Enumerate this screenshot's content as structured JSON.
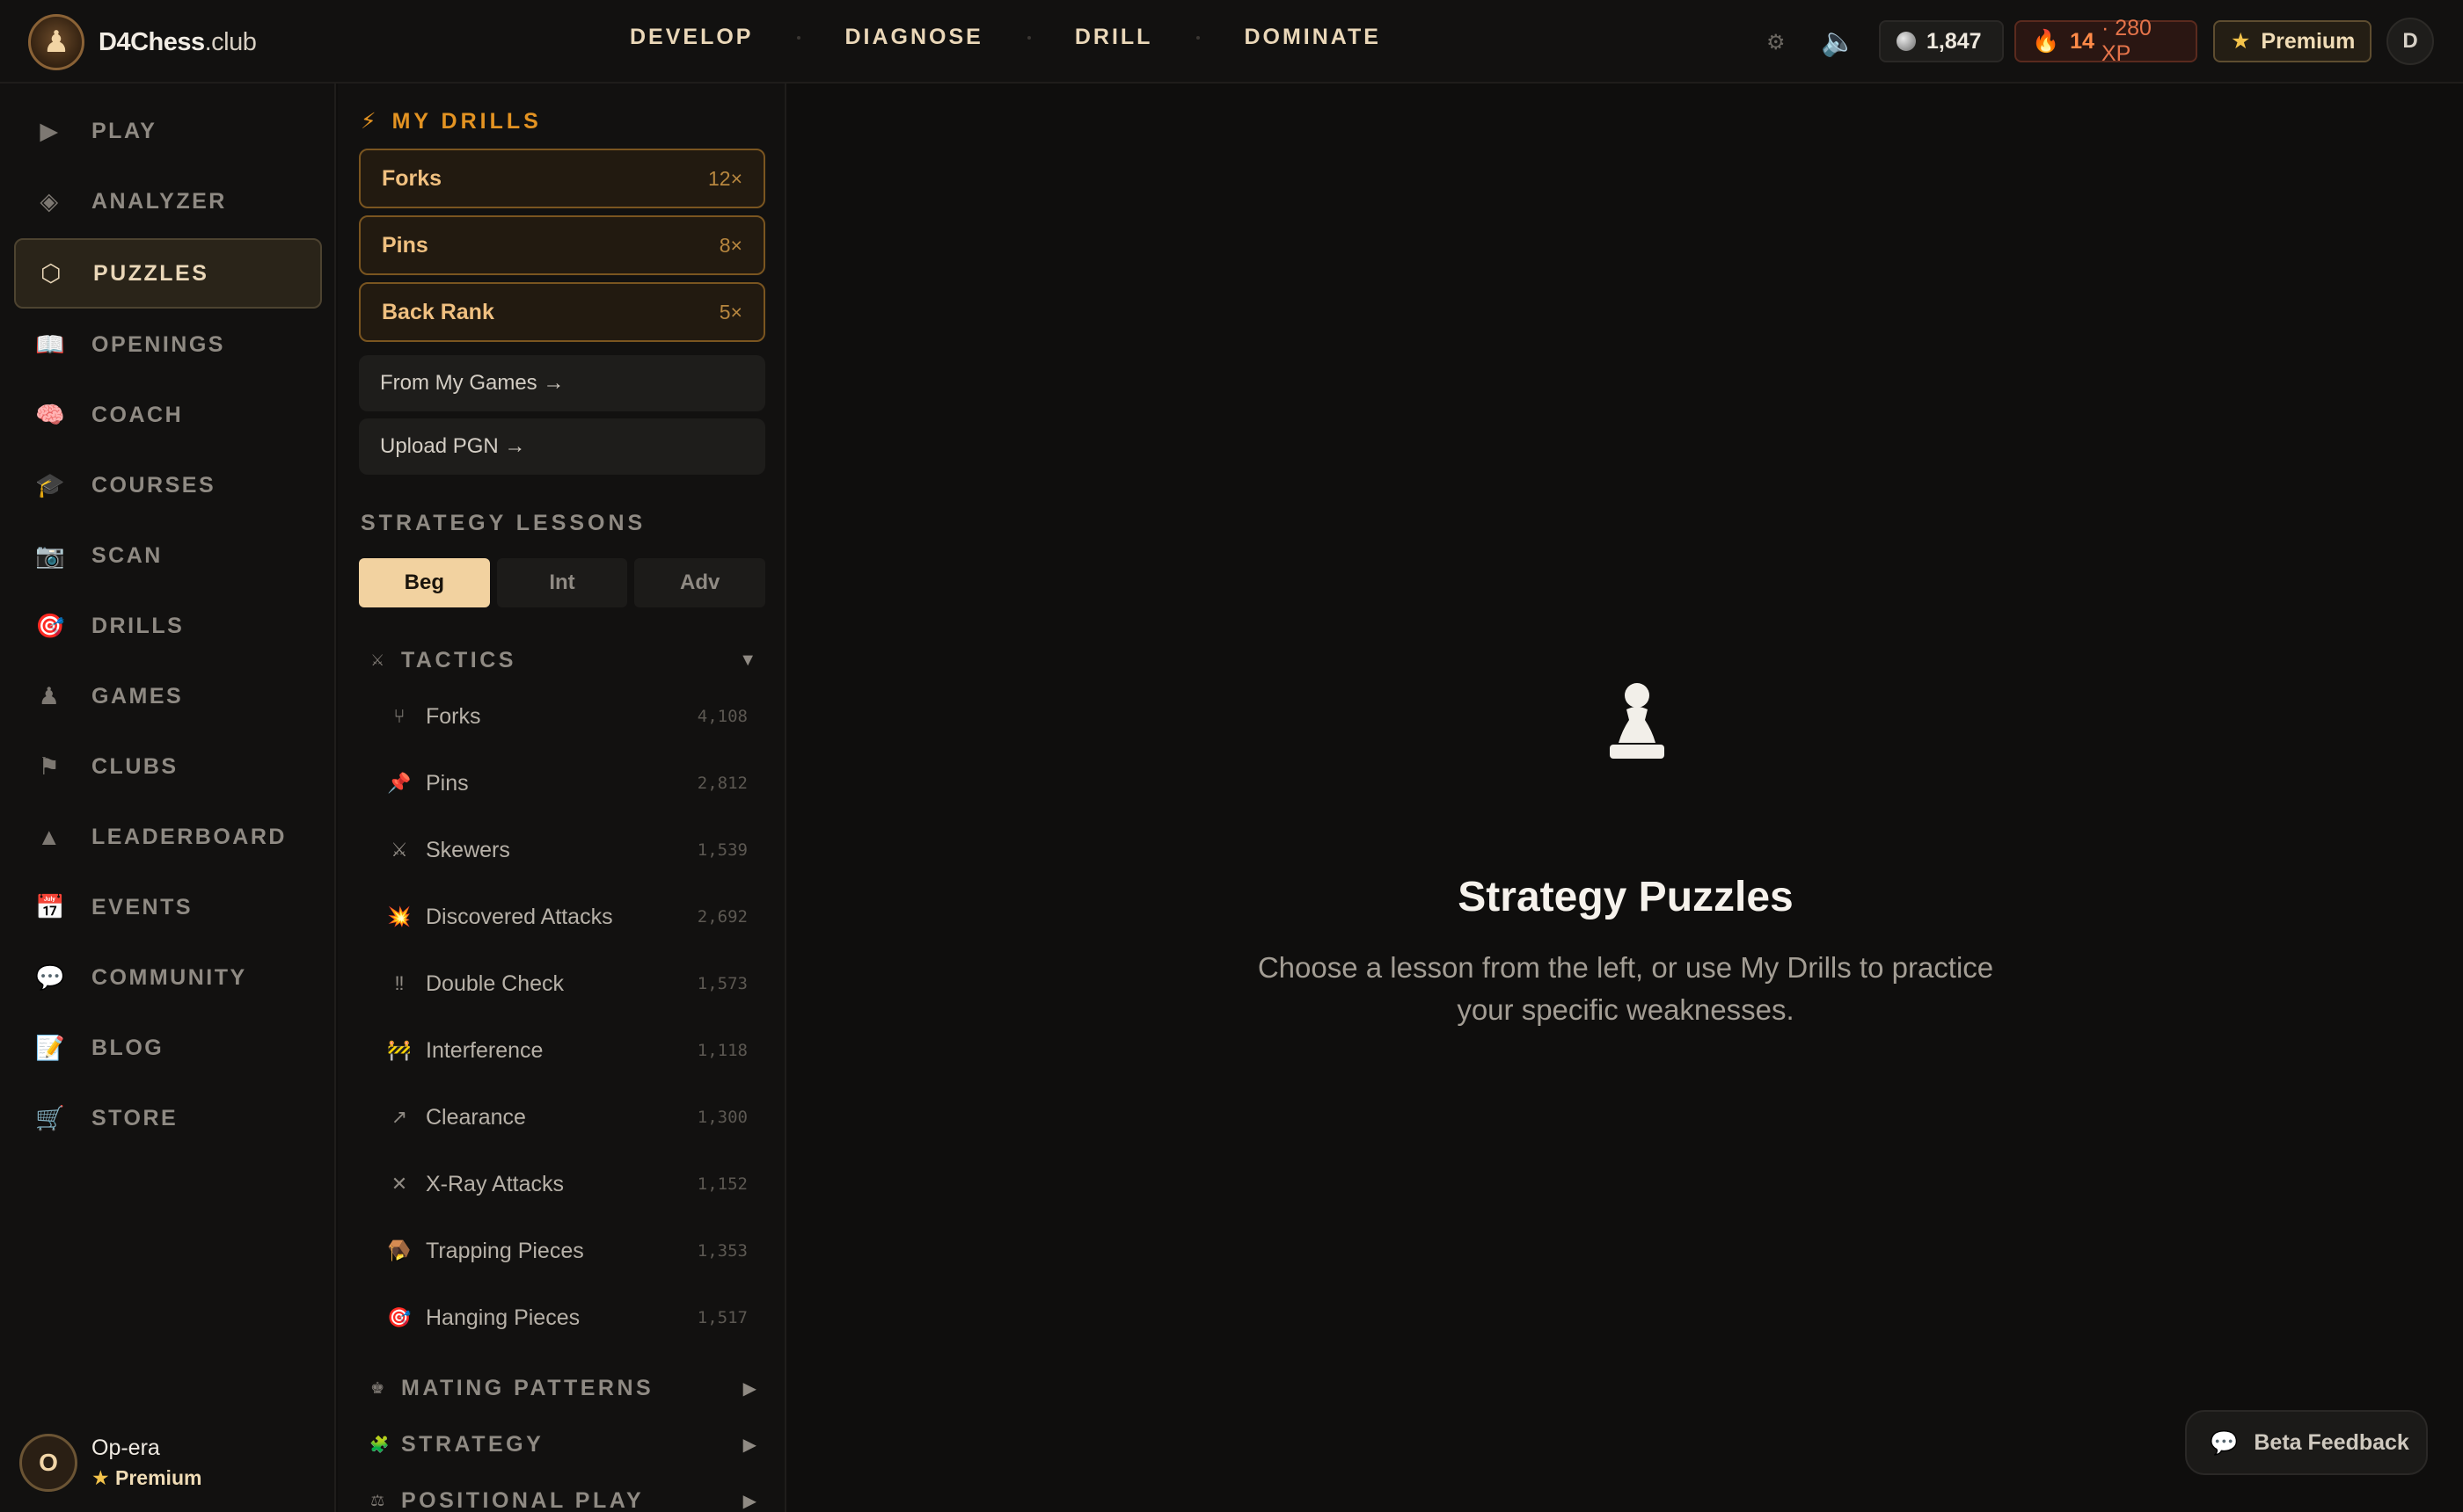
{
  "brand": {
    "name": "D4Chess",
    "suffix": ".club"
  },
  "nav": [
    "DEVELOP",
    "DIAGNOSE",
    "DRILL",
    "DOMINATE"
  ],
  "header": {
    "rating": "1,847",
    "streak": "14",
    "xp": "· 280 XP",
    "premium_label": "Premium",
    "avatar_initial": "D"
  },
  "sidebar": {
    "items": [
      {
        "label": "PLAY",
        "icon": "play-icon"
      },
      {
        "label": "ANALYZER",
        "icon": "diamond-icon"
      },
      {
        "label": "PUZZLES",
        "icon": "hexagon-icon"
      },
      {
        "label": "OPENINGS",
        "icon": "book-icon"
      },
      {
        "label": "COACH",
        "icon": "brain-icon"
      },
      {
        "label": "COURSES",
        "icon": "graduation-cap-icon"
      },
      {
        "label": "SCAN",
        "icon": "camera-icon"
      },
      {
        "label": "DRILLS",
        "icon": "target-icon"
      },
      {
        "label": "GAMES",
        "icon": "pawn-icon"
      },
      {
        "label": "CLUBS",
        "icon": "flag-icon"
      },
      {
        "label": "LEADERBOARD",
        "icon": "triangle-icon"
      },
      {
        "label": "EVENTS",
        "icon": "calendar-icon"
      },
      {
        "label": "COMMUNITY",
        "icon": "speech-bubble-icon"
      },
      {
        "label": "BLOG",
        "icon": "memo-icon"
      },
      {
        "label": "STORE",
        "icon": "cart-icon"
      }
    ],
    "active": "PUZZLES",
    "user": {
      "initial": "O",
      "name": "Op-era",
      "tier": "Premium"
    }
  },
  "panel": {
    "my_drills_title": "MY DRILLS",
    "drills": [
      {
        "label": "Forks",
        "count": "12×"
      },
      {
        "label": "Pins",
        "count": "8×"
      },
      {
        "label": "Back Rank",
        "count": "5×"
      }
    ],
    "links": [
      "From My Games →",
      "Upload PGN →"
    ],
    "strategy_title": "STRATEGY LESSONS",
    "levels": [
      "Beg",
      "Int",
      "Adv"
    ],
    "active_level": "Beg",
    "categories": {
      "tactics": "TACTICS",
      "mating": "MATING PATTERNS",
      "strategy": "STRATEGY",
      "positional": "POSITIONAL PLAY"
    },
    "lessons": [
      {
        "name": "Forks",
        "count": "4,108",
        "icon": "fork-icon"
      },
      {
        "name": "Pins",
        "count": "2,812",
        "icon": "pushpin-icon"
      },
      {
        "name": "Skewers",
        "count": "1,539",
        "icon": "swords-icon"
      },
      {
        "name": "Discovered Attacks",
        "count": "2,692",
        "icon": "explosion-icon"
      },
      {
        "name": "Double Check",
        "count": "1,573",
        "icon": "double-exclamation-icon"
      },
      {
        "name": "Interference",
        "count": "1,118",
        "icon": "barrier-icon"
      },
      {
        "name": "Clearance",
        "count": "1,300",
        "icon": "arrow-up-right-icon"
      },
      {
        "name": "X-Ray Attacks",
        "count": "1,152",
        "icon": "x-icon"
      },
      {
        "name": "Trapping Pieces",
        "count": "1,353",
        "icon": "trap-icon"
      },
      {
        "name": "Hanging Pieces",
        "count": "1,517",
        "icon": "target-icon"
      }
    ]
  },
  "main": {
    "title": "Strategy Puzzles",
    "subtitle": "Choose a lesson from the left, or use My Drills to practice your specific weaknesses."
  },
  "feedback": {
    "label": "Beta Feedback"
  }
}
